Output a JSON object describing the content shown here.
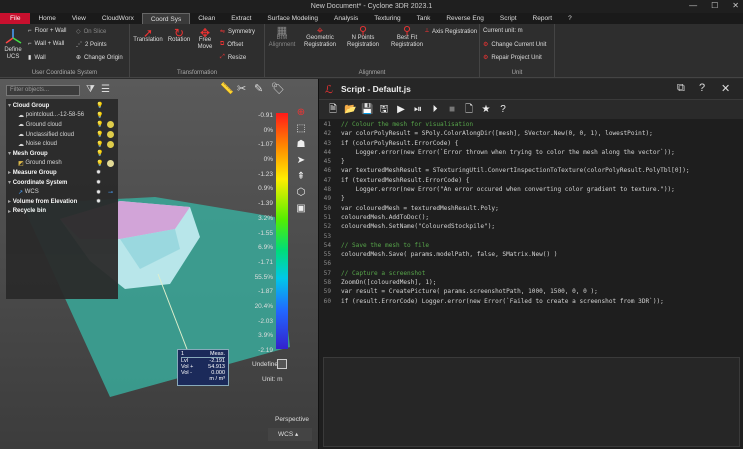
{
  "window": {
    "title": "New Document* - Cyclone 3DR 2023.1"
  },
  "menu": [
    "File",
    "Home",
    "View",
    "CloudWorx",
    "Coord Sys",
    "Clean",
    "Extract",
    "Surface Modeling",
    "Analysis",
    "Texturing",
    "Tank",
    "Reverse Eng",
    "Script",
    "Report",
    "?"
  ],
  "ribbon": {
    "define_ucs": "Define UCS",
    "floor_wall": "Floor + Wall",
    "wall_wall": "Wall + Wall",
    "wall": "Wall",
    "on_slice": "On Slice",
    "two_points": "2 Points",
    "change_origin": "Change Origin",
    "group1": "User Coordinate System",
    "translation": "Translation",
    "rotation": "Rotation",
    "free_move": "Free Move",
    "symmetry": "Symmetry",
    "offset": "Offset",
    "resize": "Resize",
    "group2": "Transformation",
    "bim_alignment": "BIM Alignment",
    "geometric_registration": "Geometric Registration",
    "npoints_registration": "N Points Registration",
    "bestfit_registration": "Best Fit Registration",
    "axis_registration": "Axis Registration",
    "group3": "Alignment",
    "current_unit": "Current unit: m",
    "change_current_unit": "Change Current Unit",
    "repair_project_unit": "Repair Project Unit",
    "group4": "Unit"
  },
  "tree": {
    "filter_placeholder": "Filter objects...",
    "items": [
      {
        "label": "Cloud Group",
        "bold": true
      },
      {
        "label": "pointcloud...-12-58-56",
        "bold": false
      },
      {
        "label": "Ground cloud",
        "bold": false
      },
      {
        "label": "Unclassified cloud",
        "bold": false
      },
      {
        "label": "Noise cloud",
        "bold": false
      },
      {
        "label": "Mesh Group",
        "bold": true
      },
      {
        "label": "Ground mesh",
        "bold": false
      },
      {
        "label": "Measure Group",
        "bold": true
      },
      {
        "label": "Coordinate System",
        "bold": true
      },
      {
        "label": "WCS",
        "bold": false
      },
      {
        "label": "Volume from Elevation",
        "bold": true
      },
      {
        "label": "Recycle bin",
        "bold": true
      }
    ]
  },
  "colorbar": {
    "labels": [
      "-0.91",
      "0%",
      "-1.07",
      "0%",
      "-1.23",
      "0.9%",
      "-1.39",
      "3.2%",
      "-1.55",
      "6.9%",
      "-1.71",
      "55.5%",
      "-1.87",
      "20.4%",
      "-2.03",
      "3.9%",
      "-2.19"
    ],
    "undefined_label": "Undefined",
    "unit_label": "Unit: m"
  },
  "measure_box": {
    "header_index": "1",
    "header_label": "Meas.",
    "rows": [
      [
        "Lvl",
        "-2.191"
      ],
      [
        "Vol +",
        "54.913"
      ],
      [
        "Vol -",
        "0.000"
      ]
    ],
    "unit": "m / m³"
  },
  "viewport": {
    "perspective_label": "Perspective",
    "wcs_label": "WCS"
  },
  "script": {
    "title": "Script - Default.js",
    "lines": [
      {
        "n": "41",
        "t": "// Colour the mesh for visualisation"
      },
      {
        "n": "42",
        "t": "var colorPolyResult = SPoly.ColorAlongDir([mesh], SVector.New(0, 0, 1), lowestPoint);"
      },
      {
        "n": "43",
        "t": "if (colorPolyResult.ErrorCode) {"
      },
      {
        "n": "44",
        "t": "    Logger.error(new Error(`Error thrown when trying to color the mesh along the vector`));"
      },
      {
        "n": "45",
        "t": "}"
      },
      {
        "n": "46",
        "t": "var texturedMeshResult = STexturingUtil.ConvertInspectionToTexture(colorPolyResult.PolyTbl[0]);"
      },
      {
        "n": "47",
        "t": "if (texturedMeshResult.ErrorCode) {"
      },
      {
        "n": "48",
        "t": "    Logger.error(new Error(\"An error occured when converting color gradient to texture.\"));"
      },
      {
        "n": "49",
        "t": "}"
      },
      {
        "n": "50",
        "t": "var colouredMesh = texturedMeshResult.Poly;"
      },
      {
        "n": "51",
        "t": "colouredMesh.AddToDoc();"
      },
      {
        "n": "52",
        "t": "colouredMesh.SetName(\"ColouredStockpile\");"
      },
      {
        "n": "53",
        "t": ""
      },
      {
        "n": "54",
        "t": "// Save the mesh to file"
      },
      {
        "n": "55",
        "t": "colouredMesh.Save( params.modelPath, false, SMatrix.New() )"
      },
      {
        "n": "56",
        "t": ""
      },
      {
        "n": "57",
        "t": "// Capture a screenshot"
      },
      {
        "n": "58",
        "t": "ZoomOn([colouredMesh], 1);"
      },
      {
        "n": "59",
        "t": "var result = CreatePicture( params.screenshotPath, 1000, 1500, 0, 0 );"
      },
      {
        "n": "60",
        "t": "if (result.ErrorCode) Logger.error(new Error(`Failed to create a screenshot from 3DR`));"
      }
    ]
  },
  "colors": {
    "accent": "#c8102e",
    "comment": "#57a64a",
    "keyword": "#569cd6",
    "string": "#d69d85",
    "func": "#dcdcaa"
  }
}
